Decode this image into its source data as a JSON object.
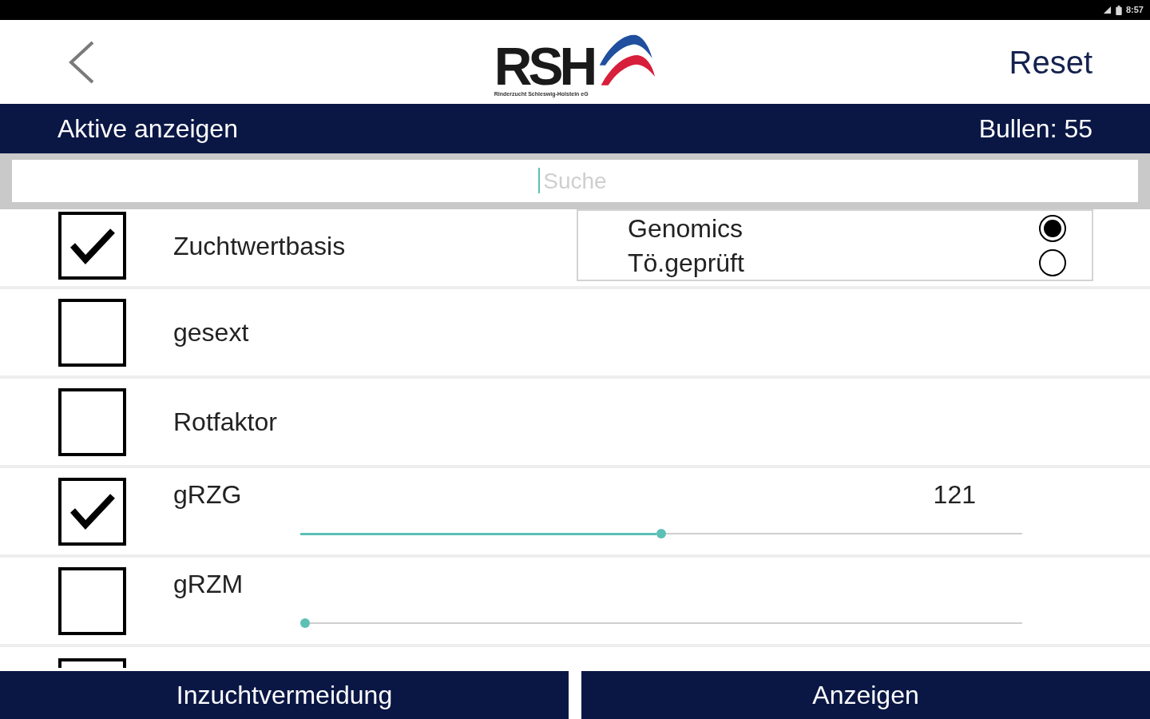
{
  "status_bar": {
    "time": "8:57"
  },
  "header": {
    "logo": {
      "text": "RSH",
      "tagline": "Rinderzucht Schleswig-Holstein eG"
    },
    "action": "Reset"
  },
  "filter_bar": {
    "title": "Aktive anzeigen",
    "count": "Bullen: 55"
  },
  "search": {
    "placeholder": "Suche"
  },
  "rows": [
    {
      "kind": "choice",
      "label": "Zuchtwertbasis",
      "checked": true,
      "options": [
        {
          "label": "Genomics",
          "selected": true
        },
        {
          "label": "Tö.geprüft",
          "selected": false
        }
      ]
    },
    {
      "kind": "plain",
      "label": "gesext",
      "checked": false
    },
    {
      "kind": "plain",
      "label": "Rotfaktor",
      "checked": false
    },
    {
      "kind": "slider",
      "label": "gRZG",
      "checked": true,
      "value": "121",
      "level": 0.5
    },
    {
      "kind": "slider",
      "label": "gRZM",
      "checked": false,
      "level": 0
    },
    {
      "kind": "partial",
      "checked": false
    }
  ],
  "buttons": [
    "Inzuchtvermeidung",
    "Anzeigen"
  ]
}
